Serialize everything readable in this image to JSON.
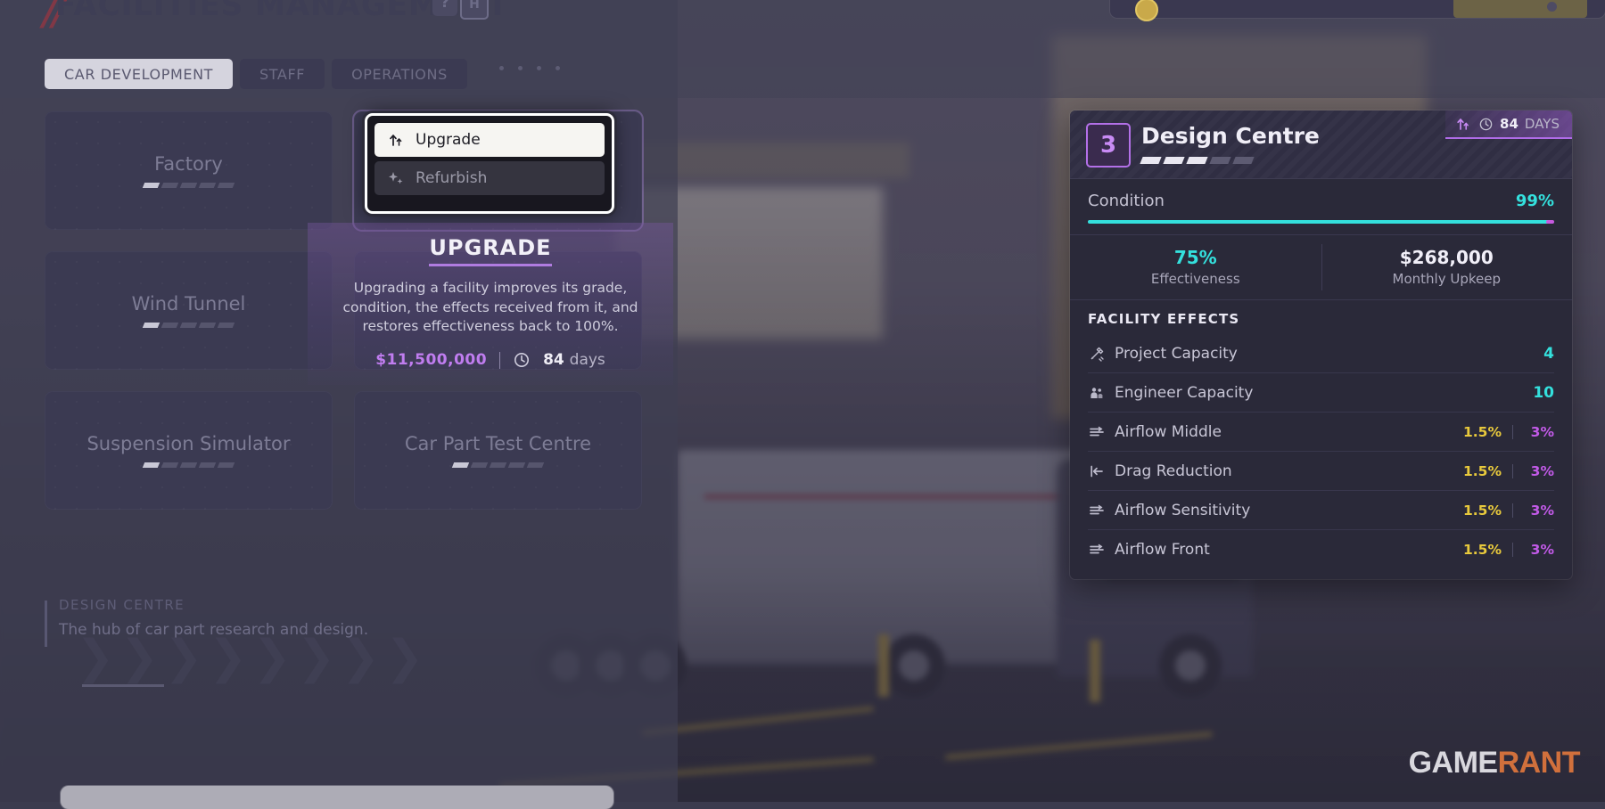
{
  "header": {
    "title": "FACILITIES MANAGEMENT",
    "help_label": "?",
    "hotkey_label": "H",
    "accent_color": "#8d3744"
  },
  "tabs": [
    {
      "label": "CAR DEVELOPMENT",
      "active": true
    },
    {
      "label": "STAFF",
      "active": false
    },
    {
      "label": "OPERATIONS",
      "active": false
    }
  ],
  "facilities": [
    {
      "name": "Factory",
      "grade_filled": 1,
      "grade_total": 5
    },
    {
      "name": "Design Centre",
      "grade_filled": 3,
      "grade_total": 5
    },
    {
      "name": "Wind Tunnel",
      "grade_filled": 1,
      "grade_total": 5
    },
    {
      "name": "",
      "grade_filled": 0,
      "grade_total": 5
    },
    {
      "name": "Suspension Simulator",
      "grade_filled": 1,
      "grade_total": 5
    },
    {
      "name": "Car Part Test Centre",
      "grade_filled": 1,
      "grade_total": 5
    }
  ],
  "context_menu": {
    "items": [
      {
        "label": "Upgrade",
        "icon": "double-up-arrow-icon",
        "highlighted": true
      },
      {
        "label": "Refurbish",
        "icon": "sparkle-icon",
        "highlighted": false
      }
    ]
  },
  "tooltip": {
    "title": "UPGRADE",
    "description": "Upgrading a facility improves its grade, condition, the effects received from it, and restores effectiveness back to 100%.",
    "cost": "$11,500,000",
    "duration": "84",
    "duration_unit": "days",
    "cost_color": "#c07df0",
    "accent_color": "#b07ce0"
  },
  "description_panel": {
    "label": "DESIGN CENTRE",
    "text": "The hub of car part research and design."
  },
  "info_panel": {
    "grade_badge": "3",
    "title": "Design Centre",
    "grade_filled": 3,
    "grade_total": 5,
    "upgrade_days_number": "84",
    "upgrade_days_unit": "DAYS",
    "condition_label": "Condition",
    "condition_value": "99%",
    "condition_percent": 99,
    "stats": [
      {
        "value": "75%",
        "label": "Effectiveness",
        "color": "#34e0dd"
      },
      {
        "value": "$268,000",
        "label": "Monthly Upkeep",
        "color": "#f1eff8"
      }
    ],
    "effects_header": "FACILITY EFFECTS",
    "effects": [
      {
        "icon": "pencil-ruler-icon",
        "name": "Project Capacity",
        "value_single": "4"
      },
      {
        "icon": "engineers-icon",
        "name": "Engineer Capacity",
        "value_single": "10"
      },
      {
        "icon": "airflow-icon",
        "name": "Airflow Middle",
        "value_current": "1.5%",
        "value_upgraded": "3%"
      },
      {
        "icon": "drag-arrow-icon",
        "name": "Drag Reduction",
        "value_current": "1.5%",
        "value_upgraded": "3%"
      },
      {
        "icon": "airflow-icon",
        "name": "Airflow Sensitivity",
        "value_current": "1.5%",
        "value_upgraded": "3%"
      },
      {
        "icon": "airflow-icon",
        "name": "Airflow Front",
        "value_current": "1.5%",
        "value_upgraded": "3%"
      }
    ]
  },
  "watermark": {
    "part_a": "GAME",
    "part_b": "RANT"
  }
}
